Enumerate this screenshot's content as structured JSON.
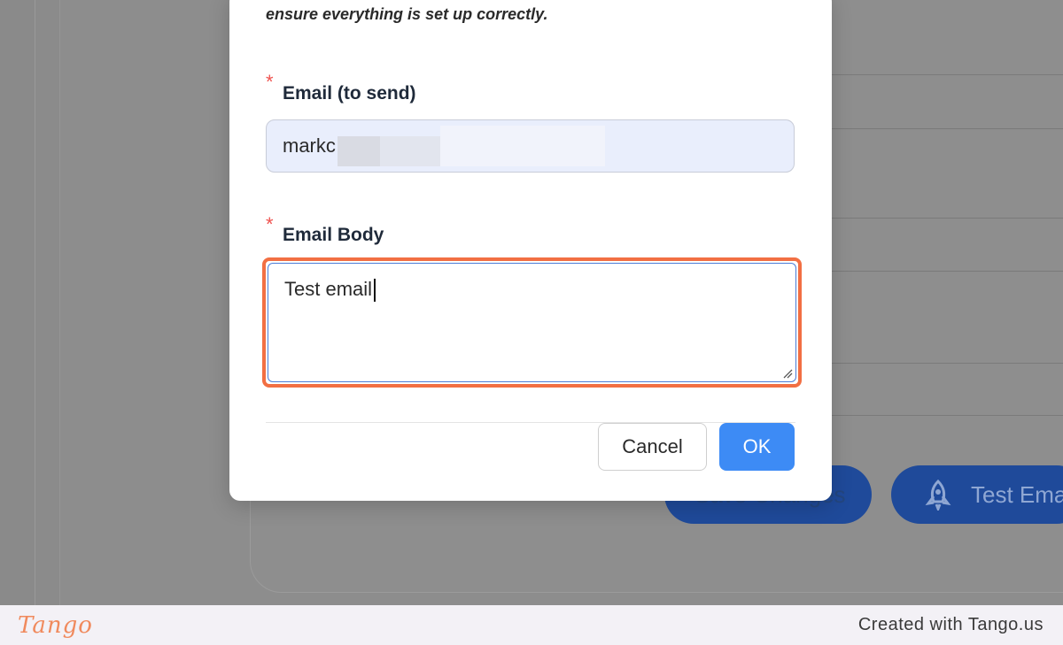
{
  "background": {
    "buttons": {
      "save_label": "Save Changes",
      "test_label": "Test Email"
    }
  },
  "modal": {
    "intro_text": "ensure everything is set up correctly.",
    "email": {
      "required_marker": "*",
      "label": "Email (to send)",
      "value": "markc"
    },
    "body": {
      "required_marker": "*",
      "label": "Email Body",
      "value": "Test email"
    },
    "actions": {
      "cancel_label": "Cancel",
      "ok_label": "OK"
    }
  },
  "footer": {
    "logo_text": "Tango",
    "credit_text": "Created with Tango.us"
  },
  "colors": {
    "highlight": "#f26f43",
    "primary": "#3d8bf5",
    "required": "#ef5350"
  }
}
